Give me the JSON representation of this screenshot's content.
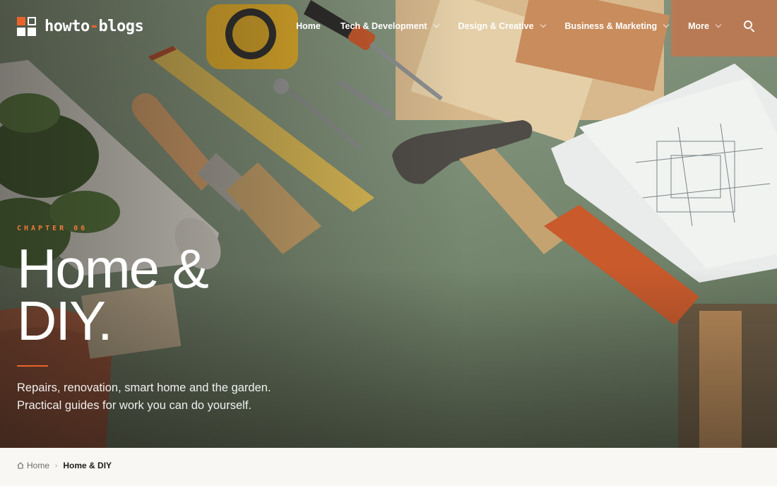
{
  "brand": {
    "name_part1": "howto",
    "name_dash": "-",
    "name_part2": "blogs",
    "accent_color": "#e8642c"
  },
  "nav": {
    "items": [
      {
        "label": "Home",
        "has_dropdown": false
      },
      {
        "label": "Tech & Development",
        "has_dropdown": true
      },
      {
        "label": "Design & Creative",
        "has_dropdown": true
      },
      {
        "label": "Business & Marketing",
        "has_dropdown": true
      },
      {
        "label": "More",
        "has_dropdown": true
      }
    ],
    "search_icon": "search-icon"
  },
  "hero": {
    "kicker": "CHAPTER 06",
    "title_line1": "Home &",
    "title_line2": "DIY.",
    "description_line1": "Repairs, renovation, smart home and the garden.",
    "description_line2": "Practical guides for work you can do yourself."
  },
  "breadcrumb": {
    "home_label": "Home",
    "current_label": "Home & DIY",
    "home_icon": "home-icon",
    "separator_icon": "chevron-right-icon"
  }
}
